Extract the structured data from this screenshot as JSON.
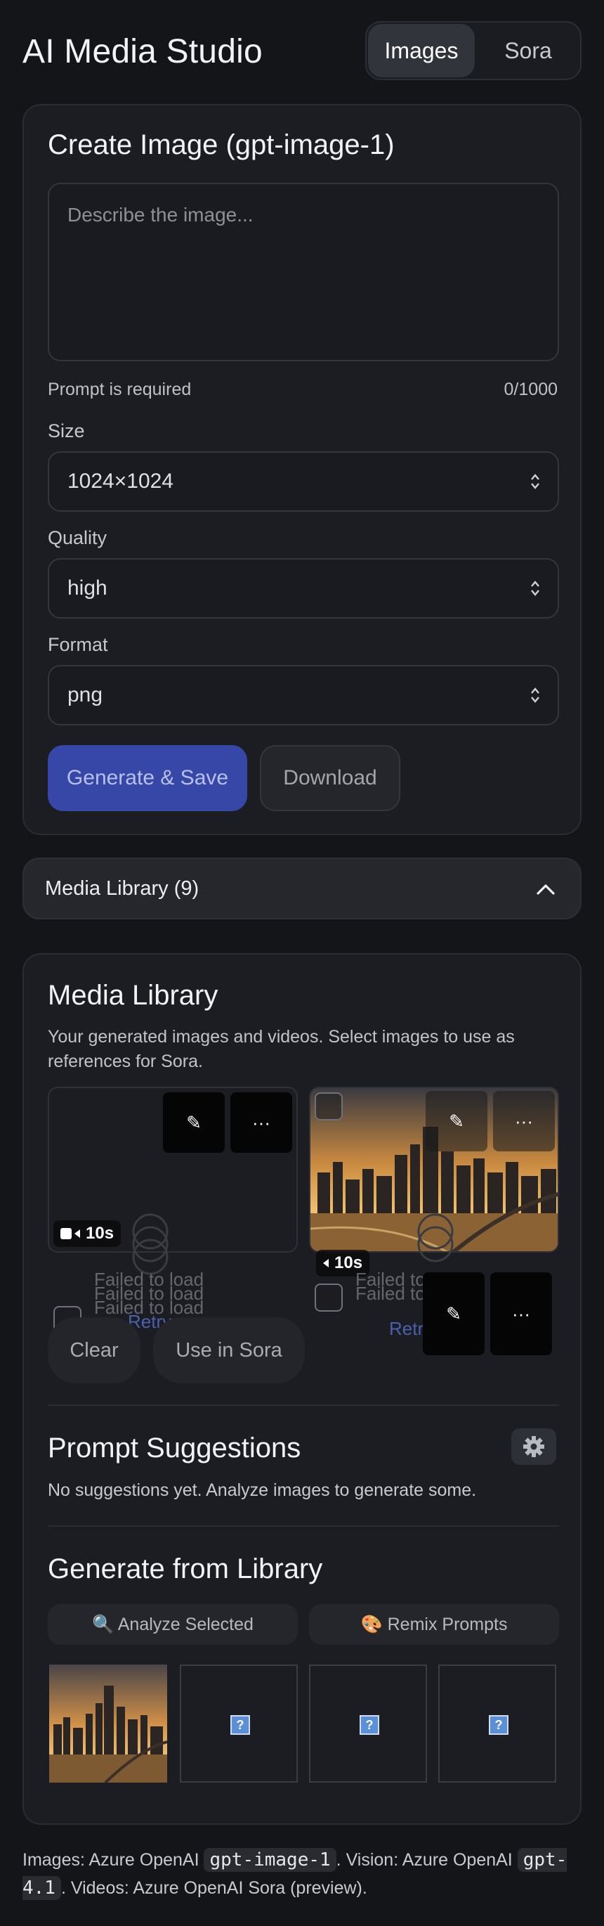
{
  "header": {
    "title": "AI Media Studio",
    "tabs": [
      "Images",
      "Sora"
    ],
    "active_tab": "Images"
  },
  "create_card": {
    "title": "Create Image (gpt-image-1)",
    "prompt_placeholder": "Describe the image...",
    "prompt_validation": "Prompt is required",
    "char_count": "0/1000",
    "size": {
      "label": "Size",
      "value": "1024×1024"
    },
    "quality": {
      "label": "Quality",
      "value": "high"
    },
    "format": {
      "label": "Format",
      "value": "png"
    },
    "generate_button": "Generate & Save",
    "download_button": "Download"
  },
  "library_toggle": {
    "label": "Media Library (9)"
  },
  "library_card": {
    "title": "Media Library",
    "subtitle": "Your generated images and videos. Select images to use as references for Sora.",
    "tiles": [
      {
        "duration": "10s",
        "status": "Failed to load",
        "retry": "Retry",
        "edit_glyph": "✎",
        "more_glyph": "···"
      },
      {
        "duration": "10s",
        "status": "Failed to load",
        "retry": "Retry",
        "edit_glyph": "✎",
        "more_glyph": "···"
      }
    ],
    "clear_button": "Clear",
    "use_in_sora_button": "Use in Sora",
    "suggestions": {
      "title": "Prompt Suggestions",
      "empty_text": "No suggestions yet. Analyze images to generate some.",
      "gear_glyph": "⚙"
    },
    "generate_from_library": {
      "title": "Generate from Library",
      "analyze_button": "🔍 Analyze Selected",
      "remix_button": "🎨 Remix Prompts",
      "thumbnails": [
        "image",
        "broken",
        "broken",
        "broken"
      ]
    }
  },
  "footer": {
    "part1": "Images: Azure OpenAI ",
    "code1": "gpt-image-1",
    "part2": ". Vision: Azure OpenAI ",
    "code2": "gpt-4.1",
    "part3": ". Videos: Azure OpenAI Sora (preview)."
  },
  "colors": {
    "accent": "#3647a8",
    "background": "#141519",
    "card": "#1c1d22"
  }
}
